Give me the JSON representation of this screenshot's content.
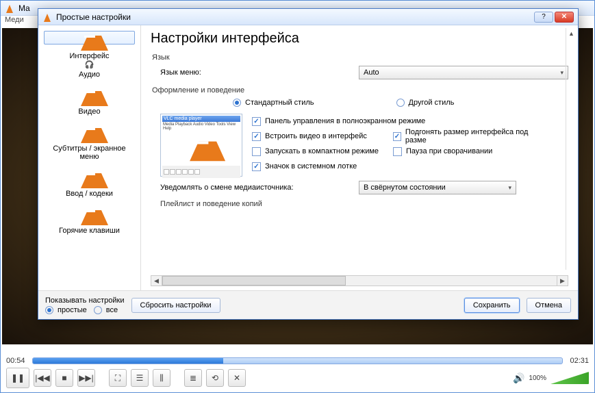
{
  "main": {
    "title_prefix": "Ma",
    "menu_visible": "Меди"
  },
  "player": {
    "time_current": "00:54",
    "time_total": "02:31",
    "volume_label": "100%"
  },
  "dialog": {
    "title": "Простые настройки",
    "heading": "Настройки интерфейса",
    "categories": {
      "interface": "Интерфейс",
      "audio": "Аудио",
      "video": "Видео",
      "subs": "Субтитры / экранное меню",
      "input": "Ввод / кодеки",
      "hotkeys": "Горячие клавиши"
    },
    "lang": {
      "section": "Язык",
      "label": "Язык меню:",
      "value": "Auto"
    },
    "look": {
      "section": "Оформление и поведение",
      "radio_standard": "Стандартный стиль",
      "radio_other": "Другой стиль",
      "chk_fullscreen_ctrl": "Панель управления в полноэкранном режиме",
      "chk_embed": "Встроить видео в интерфейс",
      "chk_resize": "Подгонять размер интерфейса под разме",
      "chk_compact": "Запускать в компактном режиме",
      "chk_pause_min": "Пауза при сворачивании",
      "chk_tray": "Значок в системном лотке",
      "notify_label": "Уведомлять о смене медиаисточника:",
      "notify_value": "В свёрнутом состоянии",
      "preview_title": "VLC media player",
      "preview_menu": "Media Playback Audio Video Tools View Help"
    },
    "playlist_section": "Плейлист и поведение копий",
    "footer": {
      "show_label": "Показывать настройки",
      "radio_simple": "простые",
      "radio_all": "все",
      "reset": "Сбросить настройки",
      "save": "Сохранить",
      "cancel": "Отмена"
    }
  }
}
